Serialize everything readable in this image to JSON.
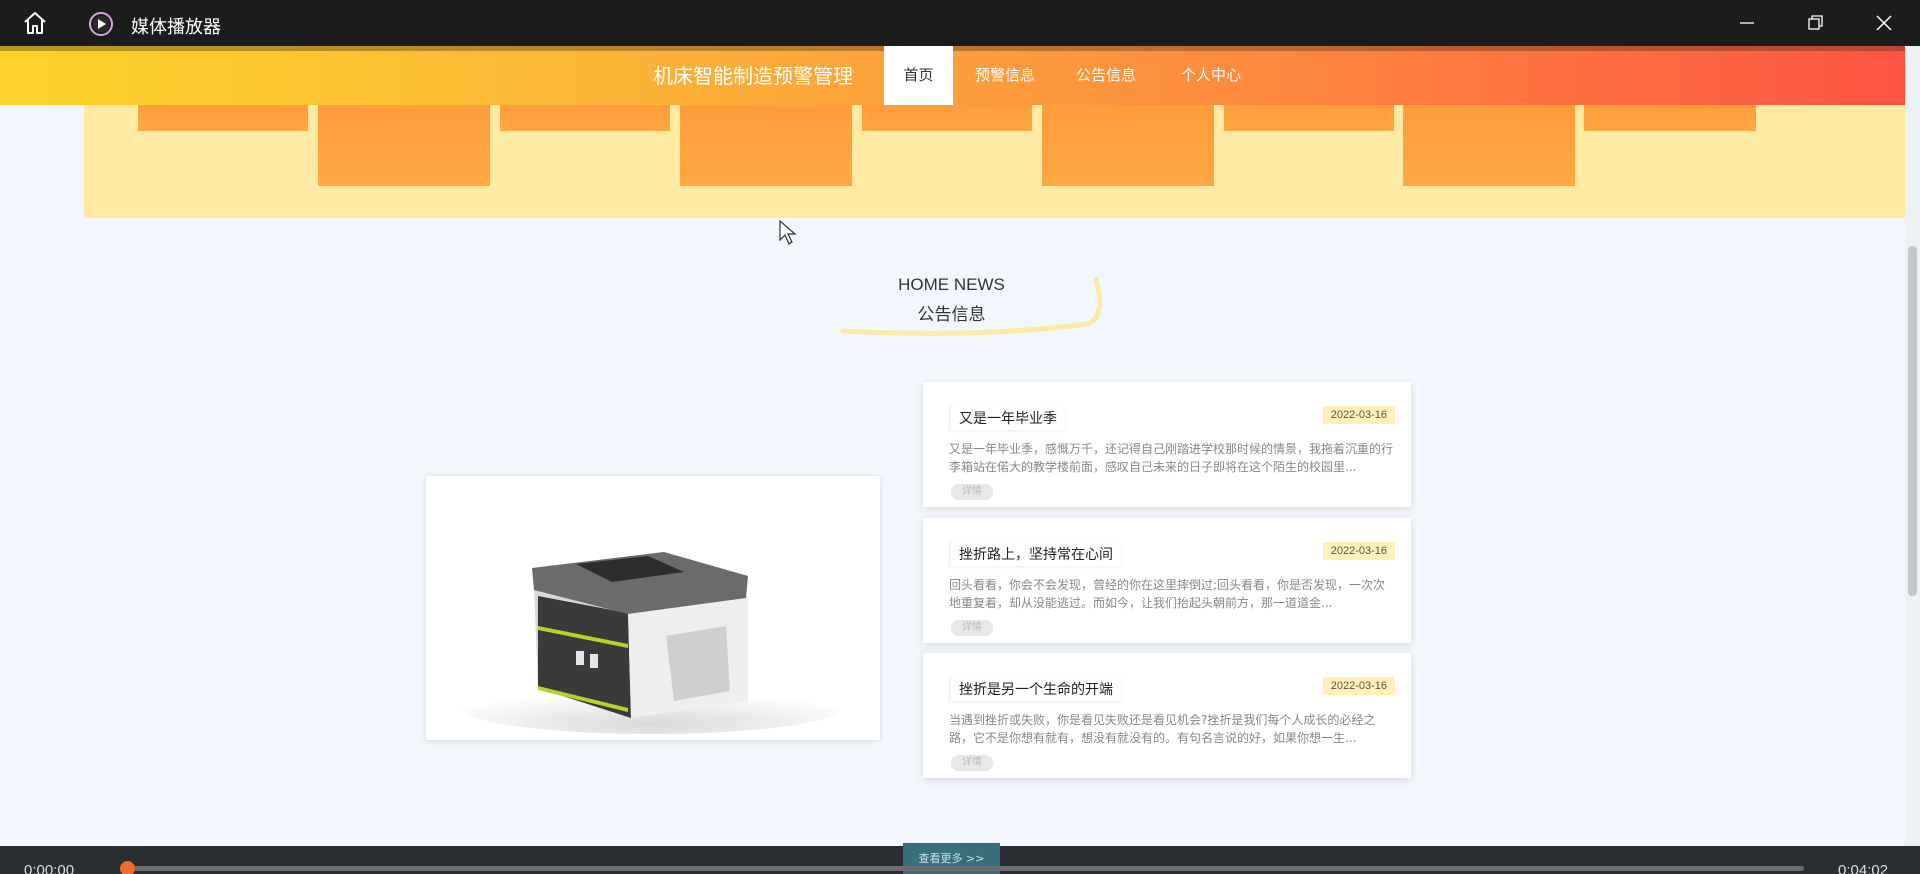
{
  "window": {
    "title": "媒体播放器",
    "icons": [
      "home-icon",
      "play-icon",
      "minimize-icon",
      "maximize-icon",
      "close-icon"
    ]
  },
  "site": {
    "title": "机床智能制造预警管理",
    "nav": [
      {
        "label": "首页",
        "active": true
      },
      {
        "label": "预警信息",
        "active": false
      },
      {
        "label": "公告信息",
        "active": false
      },
      {
        "label": "个人中心",
        "active": false
      }
    ]
  },
  "section": {
    "title_en": "HOME NEWS",
    "title_cn": "公告信息"
  },
  "news": [
    {
      "title": "又是一年毕业季",
      "date": "2022-03-16",
      "body": "又是一年毕业季，感慨万千，还记得自己刚踏进学校那时候的情景，我拖着沉重的行李箱站在偌大的教学楼前面，感叹自己未来的日子即将在这个陌生的校园里...",
      "button": "详情"
    },
    {
      "title": "挫折路上，坚持常在心间",
      "date": "2022-03-16",
      "body": "回头看看，你会不会发现，曾经的你在这里摔倒过;回头看看，你是否发现，一次次地重复着，却从没能逃过。而如今，让我们抬起头朝前方，那一道道金...",
      "button": "详情"
    },
    {
      "title": "挫折是另一个生命的开端",
      "date": "2022-03-16",
      "body": "当遇到挫折或失败，你是看见失败还是看见机会?挫折是我们每个人成长的必经之路，它不是你想有就有，想没有就没有的。有句名言说的好，如果你想一生...",
      "button": "详情"
    }
  ],
  "more_button": "查看更多 >>",
  "player": {
    "time_current": "0:00:00",
    "time_total": "0:04:02",
    "progress": 0.0,
    "accent_color": "#f26a2e"
  },
  "colors": {
    "nav_gradient_start": "#fbd32a",
    "nav_gradient_end": "#fd5443",
    "band": "#ffe9a3",
    "box": "#ffa842"
  }
}
